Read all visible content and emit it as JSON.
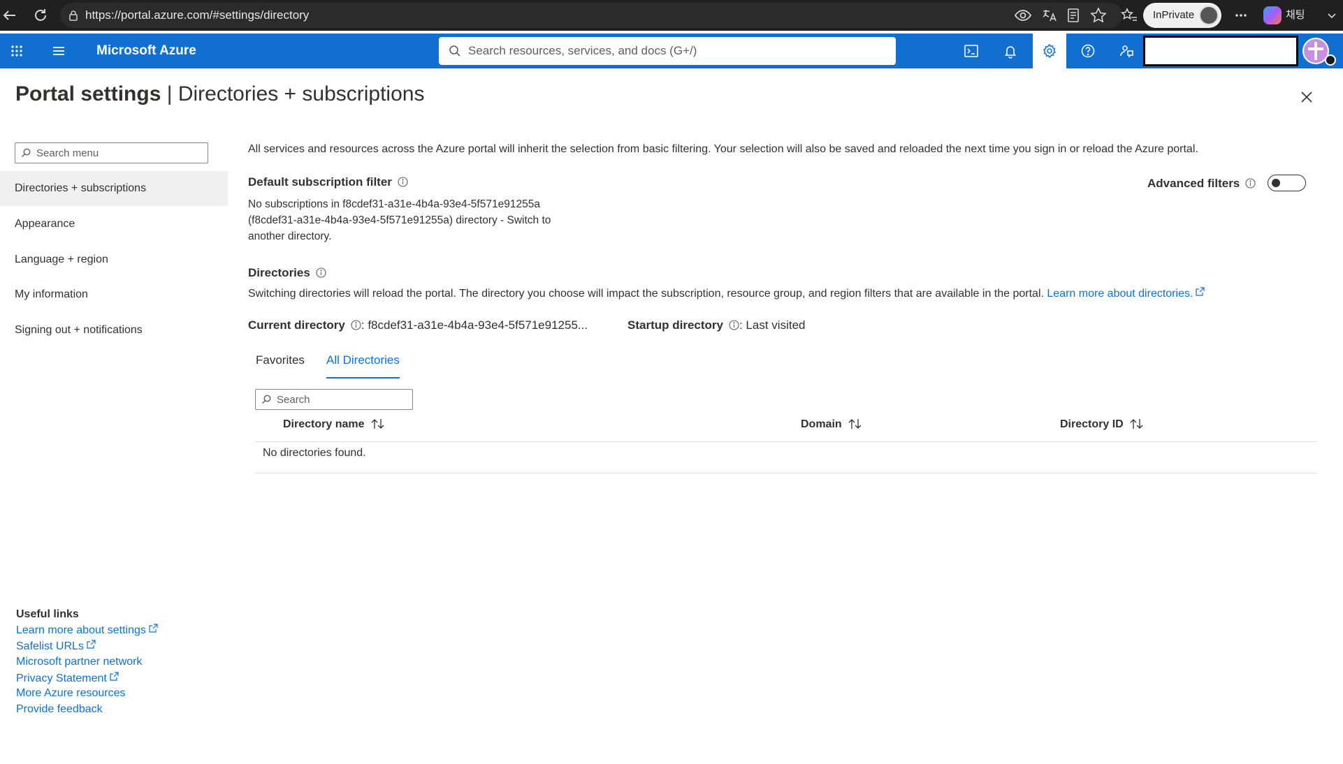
{
  "browser": {
    "url": "https://portal.azure.com/#settings/directory",
    "inprivate_label": "InPrivate",
    "chat_label": "채팅"
  },
  "header": {
    "brand": "Microsoft Azure",
    "search_placeholder": "Search resources, services, and docs (G+/)"
  },
  "page": {
    "title_strong": "Portal settings",
    "title_rest": " | Directories + subscriptions"
  },
  "sidebar": {
    "search_placeholder": "Search menu",
    "items": [
      {
        "label": "Directories + subscriptions"
      },
      {
        "label": "Appearance"
      },
      {
        "label": "Language + region"
      },
      {
        "label": "My information"
      },
      {
        "label": "Signing out + notifications"
      }
    ],
    "useful_links_title": "Useful links",
    "useful_links": [
      {
        "label": "Learn more about settings"
      },
      {
        "label": "Safelist URLs"
      },
      {
        "label": "Microsoft partner network"
      },
      {
        "label": "Privacy Statement"
      },
      {
        "label": "More Azure resources"
      },
      {
        "label": "Provide feedback"
      }
    ]
  },
  "main": {
    "intro": "All services and resources across the Azure portal will inherit the selection from basic filtering. Your selection will also be saved and reloaded the next time you sign in or reload the Azure portal.",
    "default_filter_title": "Default subscription filter",
    "default_filter_text": "No subscriptions in f8cdef31-a31e-4b4a-93e4-5f571e91255a (f8cdef31-a31e-4b4a-93e4-5f571e91255a) directory - Switch to another directory.",
    "advanced_filters_label": "Advanced filters",
    "directories_title": "Directories",
    "directories_desc": "Switching directories will reload the portal. The directory you choose will impact the subscription, resource group, and region filters that are available in the portal.",
    "directories_link": "Learn more about directories.",
    "current_directory_label": "Current directory",
    "current_directory_value": ": f8cdef31-a31e-4b4a-93e4-5f571e91255...",
    "startup_directory_label": "Startup directory",
    "startup_directory_value": ": Last visited",
    "tabs": [
      {
        "label": "Favorites"
      },
      {
        "label": "All Directories"
      }
    ],
    "table_search_placeholder": "Search",
    "columns": [
      {
        "label": "Directory name"
      },
      {
        "label": "Domain"
      },
      {
        "label": "Directory ID"
      }
    ],
    "empty_text": "No directories found."
  },
  "colors": {
    "azure_blue": "#1170cf",
    "browser_dark": "#202020"
  }
}
